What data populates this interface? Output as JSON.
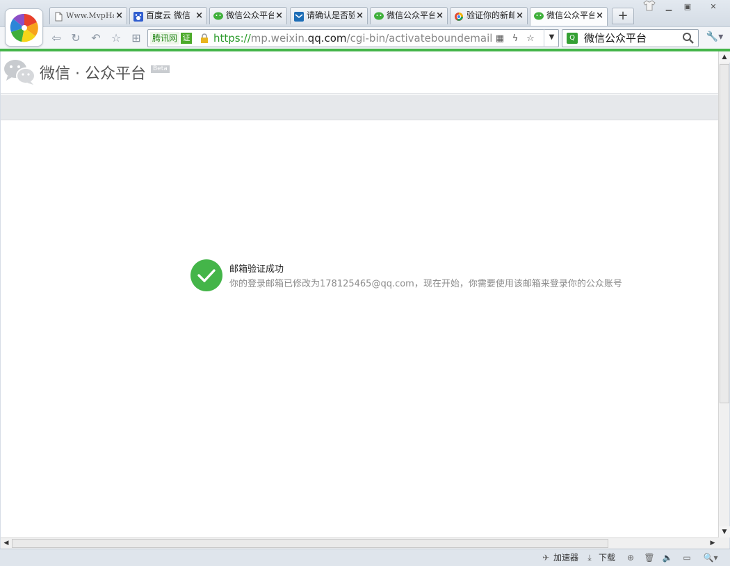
{
  "browser": {
    "tabs": [
      {
        "title": "Www.MvpHack",
        "icon": "document-icon"
      },
      {
        "title": "百度云 微信",
        "icon": "baidu-icon"
      },
      {
        "title": "微信公众平台",
        "icon": "wechat-icon"
      },
      {
        "title": "请确认是否验",
        "icon": "qq-mail-icon"
      },
      {
        "title": "微信公众平台",
        "icon": "wechat-icon"
      },
      {
        "title": "验证你的新邮",
        "icon": "browser-icon"
      },
      {
        "title": "微信公众平台",
        "icon": "wechat-icon"
      }
    ],
    "active_tab_index": 6,
    "new_tab_label": "+",
    "close_glyph": "×",
    "address": {
      "badge_site": "腾讯网",
      "badge_cert": "证",
      "url_scheme": "https://",
      "url_host_prefix": "mp.weixin.",
      "url_host_domain": "qq.com",
      "url_path": "/cgi-bin/activateboundemail"
    },
    "search": {
      "value": "微信公众平台",
      "engine_icon": "sogou-search-icon"
    }
  },
  "page": {
    "brand": "微信 · 公众平台",
    "beta_badge": "Beta",
    "message": {
      "title": "邮箱验证成功",
      "description": "你的登录邮箱已修改为178125465@qq.com，现在开始，你需要使用该邮箱来登录你的公众账号"
    }
  },
  "statusbar": {
    "accelerator": "加速器",
    "download": "下载"
  },
  "colors": {
    "accent_green": "#44b549",
    "url_green": "#2a9a2a"
  }
}
